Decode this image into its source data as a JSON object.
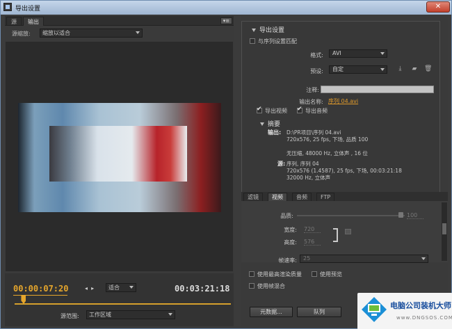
{
  "window": {
    "title": "导出设置",
    "close": "✕"
  },
  "left_tabs": [
    {
      "label": "源"
    },
    {
      "label": "输出"
    }
  ],
  "source_scale": {
    "label": "源缩放:",
    "value": "缩放以适合"
  },
  "timeline": {
    "current_time": "00:00:07:20",
    "fit_value": "适合",
    "end_time": "00:03:21:18",
    "range_label": "源范围:",
    "range_value": "工作区域",
    "playhead_fraction": 0.04
  },
  "export_settings": {
    "section_title": "导出设置",
    "match_sequence": "与序列设置匹配",
    "format_label": "格式:",
    "format_value": "AVI",
    "preset_label": "预设:",
    "preset_value": "自定",
    "comment_label": "注释:",
    "output_name_label": "输出名称:",
    "output_name_value": "序列 04.avi",
    "export_video": "导出视频",
    "export_audio": "导出音频"
  },
  "summary": {
    "title": "摘要",
    "output_key": "输出:",
    "output_lines": [
      "D:\\PR项目\\序列 04.avi",
      "720x576, 25 fps, 下场, 品质 100",
      "",
      "无压缩, 48000 Hz, 立体声 , 16 位"
    ],
    "source_key": "源:",
    "source_lines": [
      "序列, 序列 04",
      "720x576 (1.4587), 25 fps, 下场, 00:03:21:18",
      "32000 Hz, 立体声"
    ]
  },
  "sub_tabs": [
    {
      "label": "滤镜"
    },
    {
      "label": "视频"
    },
    {
      "label": "音频"
    },
    {
      "label": "FTP"
    }
  ],
  "video_panel": {
    "quality_label": "品质:",
    "quality_value": "100",
    "width_label": "宽度:",
    "width_value": "720",
    "height_label": "高度:",
    "height_value": "576",
    "framerate_label": "帧速率:",
    "framerate_value": "25"
  },
  "bottom_options": {
    "max_render": "使用最高渲染质量",
    "use_preview": "使用预览",
    "frame_blend": "使用帧混合"
  },
  "buttons": {
    "metadata": "元数据...",
    "queue": "队列"
  },
  "watermark": {
    "text": "电脑公司装机大师",
    "sub": "www.DNGSOS.COM"
  }
}
